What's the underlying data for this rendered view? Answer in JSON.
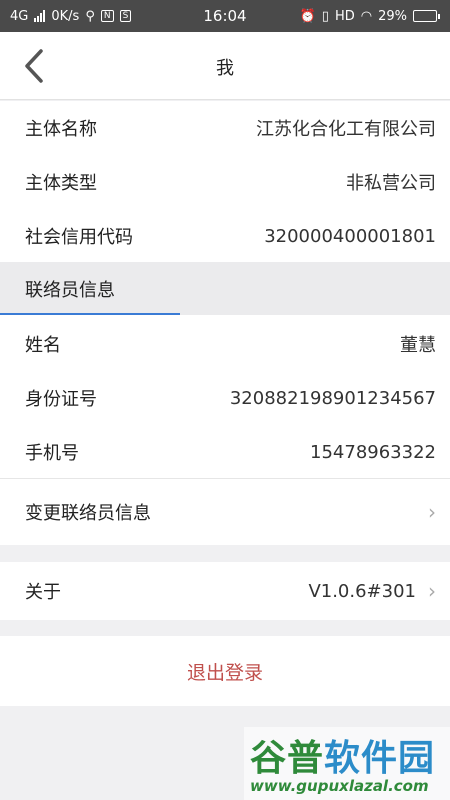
{
  "status_bar": {
    "network": "4G",
    "speed": "0K/s",
    "hd_badge": "HD",
    "time": "16:04",
    "battery_percent_text": "29%",
    "battery_level": 0.29
  },
  "header": {
    "title": "我"
  },
  "company": {
    "name_label": "主体名称",
    "name_value": "江苏化合化工有限公司",
    "type_label": "主体类型",
    "type_value": "非私营公司",
    "credit_label": "社会信用代码",
    "credit_value": "320000400001801"
  },
  "contact_section": {
    "title": "联络员信息",
    "name_label": "姓名",
    "name_value": "董慧",
    "id_label": "身份证号",
    "id_value": "320882198901234567",
    "phone_label": "手机号",
    "phone_value": "15478963322",
    "change_label": "变更联络员信息"
  },
  "about": {
    "label": "关于",
    "version": "V1.0.6#301"
  },
  "logout_label": "退出登录",
  "watermark": {
    "brand_part1": "谷普",
    "brand_part2": "软件园",
    "url": "www.gupuxlazal.com"
  },
  "colors": {
    "accent": "#3a7bd5",
    "logout": "#c0504d",
    "status_bar": "#4a4a4a"
  }
}
